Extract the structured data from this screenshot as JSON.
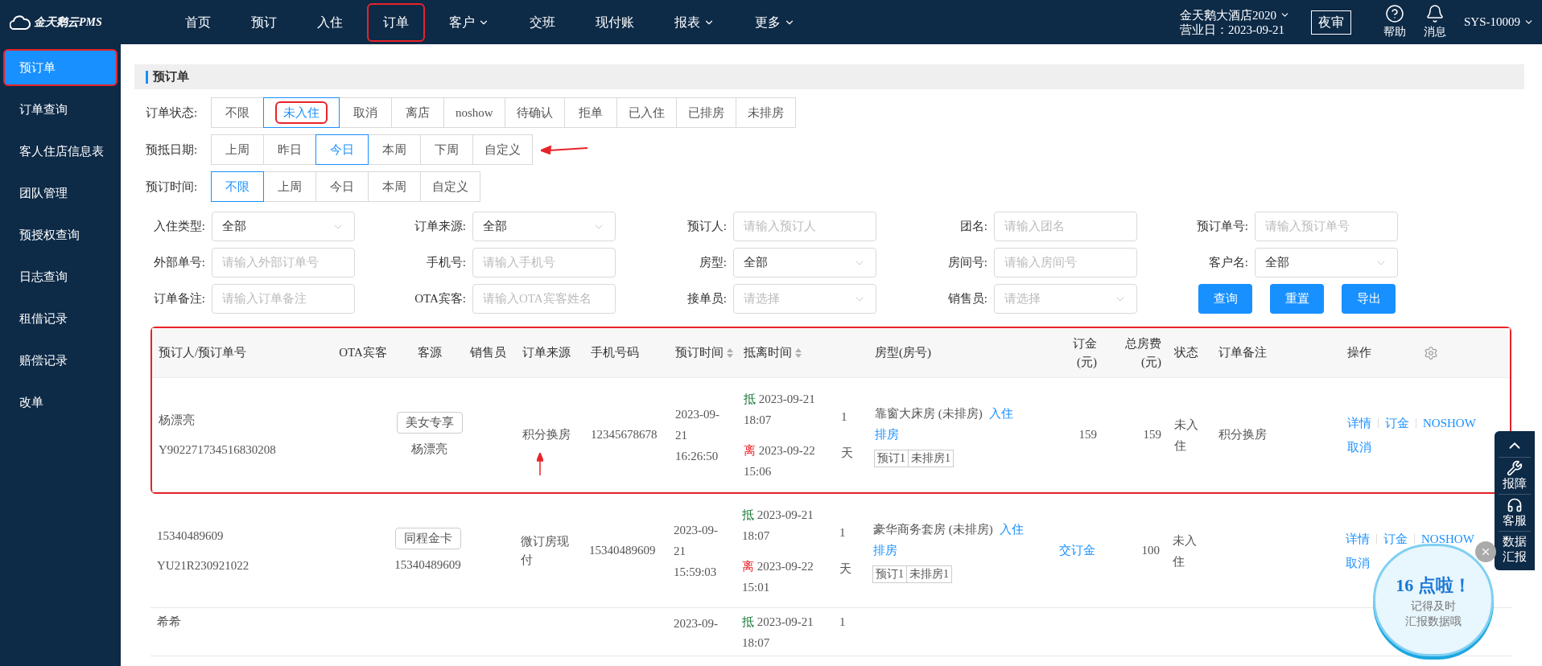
{
  "app": {
    "logo_text": "金天鹅云PMS"
  },
  "nav": [
    {
      "label": "首页",
      "dropdown": false,
      "annotated": false
    },
    {
      "label": "预订",
      "dropdown": false,
      "annotated": false
    },
    {
      "label": "入住",
      "dropdown": false,
      "annotated": false
    },
    {
      "label": "订单",
      "dropdown": false,
      "annotated": true
    },
    {
      "label": "客户",
      "dropdown": true,
      "annotated": false
    },
    {
      "label": "交班",
      "dropdown": false,
      "annotated": false
    },
    {
      "label": "现付账",
      "dropdown": false,
      "annotated": false
    },
    {
      "label": "报表",
      "dropdown": true,
      "annotated": false
    },
    {
      "label": "更多",
      "dropdown": true,
      "annotated": false
    }
  ],
  "hotel": {
    "name": "金天鹅大酒店2020",
    "business_day": "营业日：2023-09-21"
  },
  "night_audit": "夜审",
  "help": "帮助",
  "messages": "消息",
  "user": "SYS-10009",
  "sidebar": [
    {
      "label": "预订单",
      "selected": true,
      "annotated": true
    },
    {
      "label": "订单查询",
      "selected": false,
      "annotated": false
    },
    {
      "label": "客人住店信息表",
      "selected": false,
      "annotated": false
    },
    {
      "label": "团队管理",
      "selected": false,
      "annotated": false
    },
    {
      "label": "预授权查询",
      "selected": false,
      "annotated": false
    },
    {
      "label": "日志查询",
      "selected": false,
      "annotated": false
    },
    {
      "label": "租借记录",
      "selected": false,
      "annotated": false
    },
    {
      "label": "赔偿记录",
      "selected": false,
      "annotated": false
    },
    {
      "label": "改单",
      "selected": false,
      "annotated": false
    }
  ],
  "panel_title": "预订单",
  "filters": [
    {
      "label": "订单状态:",
      "arrow": false,
      "options": [
        {
          "label": "不限",
          "selected": false,
          "annotated": false
        },
        {
          "label": "未入住",
          "selected": true,
          "annotated": true
        },
        {
          "label": "取消",
          "selected": false,
          "annotated": false
        },
        {
          "label": "离店",
          "selected": false,
          "annotated": false
        },
        {
          "label": "noshow",
          "selected": false,
          "annotated": false
        },
        {
          "label": "待确认",
          "selected": false,
          "annotated": false
        },
        {
          "label": "拒单",
          "selected": false,
          "annotated": false
        },
        {
          "label": "已入住",
          "selected": false,
          "annotated": false
        },
        {
          "label": "已排房",
          "selected": false,
          "annotated": false
        },
        {
          "label": "未排房",
          "selected": false,
          "annotated": false
        }
      ]
    },
    {
      "label": "预抵日期:",
      "arrow": true,
      "options": [
        {
          "label": "上周",
          "selected": false,
          "annotated": false
        },
        {
          "label": "昨日",
          "selected": false,
          "annotated": false
        },
        {
          "label": "今日",
          "selected": true,
          "annotated": false
        },
        {
          "label": "本周",
          "selected": false,
          "annotated": false
        },
        {
          "label": "下周",
          "selected": false,
          "annotated": false
        },
        {
          "label": "自定义",
          "selected": false,
          "annotated": false
        }
      ]
    },
    {
      "label": "预订时间:",
      "arrow": false,
      "options": [
        {
          "label": "不限",
          "selected": true,
          "annotated": false
        },
        {
          "label": "上周",
          "selected": false,
          "annotated": false
        },
        {
          "label": "今日",
          "selected": false,
          "annotated": false
        },
        {
          "label": "本周",
          "selected": false,
          "annotated": false
        },
        {
          "label": "自定义",
          "selected": false,
          "annotated": false
        }
      ]
    }
  ],
  "form_fields": [
    {
      "label": "入住类型:",
      "kind": "select",
      "value": "全部"
    },
    {
      "label": "订单来源:",
      "kind": "select",
      "value": "全部"
    },
    {
      "label": "预订人:",
      "kind": "input",
      "placeholder": "请输入预订人"
    },
    {
      "label": "团名:",
      "kind": "input",
      "placeholder": "请输入团名"
    },
    {
      "label": "预订单号:",
      "kind": "input",
      "placeholder": "请输入预订单号"
    },
    {
      "label": "外部单号:",
      "kind": "input",
      "placeholder": "请输入外部订单号"
    },
    {
      "label": "手机号:",
      "kind": "input",
      "placeholder": "请输入手机号"
    },
    {
      "label": "房型:",
      "kind": "select",
      "value": "全部"
    },
    {
      "label": "房间号:",
      "kind": "input",
      "placeholder": "请输入房间号"
    },
    {
      "label": "客户名:",
      "kind": "select",
      "value": "全部"
    },
    {
      "label": "订单备注:",
      "kind": "input",
      "placeholder": "请输入订单备注"
    },
    {
      "label": "OTA宾客:",
      "kind": "input",
      "placeholder": "请输入OTA宾客姓名"
    },
    {
      "label": "接单员:",
      "kind": "select",
      "placeholder": "请选择"
    },
    {
      "label": "销售员:",
      "kind": "select",
      "placeholder": "请选择"
    }
  ],
  "buttons": [
    "查询",
    "重置",
    "导出"
  ],
  "table": {
    "annotated": true,
    "columns": [
      {
        "label": "预订人/预订单号",
        "sortable": false
      },
      {
        "label": "OTA宾客",
        "sortable": false
      },
      {
        "label": "客源",
        "sortable": false
      },
      {
        "label": "销售员",
        "sortable": false
      },
      {
        "label": "订单来源",
        "sortable": false
      },
      {
        "label": "手机号码",
        "sortable": false
      },
      {
        "label": "预订时间",
        "sortable": true
      },
      {
        "label": "抵离时间",
        "sortable": true
      },
      {
        "label": "房型(房号)",
        "sortable": false
      },
      {
        "label": "订金(元)",
        "sortable": false
      },
      {
        "label": "总房费(元)",
        "sortable": false
      },
      {
        "label": "状态",
        "sortable": false
      },
      {
        "label": "订单备注",
        "sortable": false
      },
      {
        "label": "操作",
        "sortable": false
      }
    ],
    "rows": [
      {
        "booker": "杨漂亮",
        "order_no": "Y902271734516830208",
        "source_tag": "美女专享",
        "source_name": "杨漂亮",
        "channel": "积分换房",
        "channel_arrow": true,
        "phone": "12345678678",
        "booked_at": [
          "2023-09-",
          "21",
          "16:26:50"
        ],
        "arrive": {
          "tag": "抵",
          "date": "2023-09-21",
          "time": "18:07"
        },
        "depart": {
          "tag": "离",
          "date": "2023-09-22",
          "time": "15:06"
        },
        "nights": "1",
        "nights_unit": "天",
        "room": "靠窗大床房 (未排房)",
        "room_links": [
          "入住",
          "排房"
        ],
        "room_tags": [
          "预订1",
          "未排房1"
        ],
        "deposit": {
          "text": "159",
          "link": false
        },
        "total": "159",
        "status": "未入住",
        "remark": "积分换房",
        "actions": [
          "详情",
          "订金",
          "NOSHOW",
          "取消"
        ]
      },
      {
        "booker": "15340489609",
        "order_no": "YU21R230921022",
        "source_tag": "同程金卡",
        "source_name": "15340489609",
        "channel": "微订房现付",
        "channel_arrow": false,
        "phone": "15340489609",
        "booked_at": [
          "2023-09-",
          "21",
          "15:59:03"
        ],
        "arrive": {
          "tag": "抵",
          "date": "2023-09-21",
          "time": "18:07"
        },
        "depart": {
          "tag": "离",
          "date": "2023-09-22",
          "time": "15:01"
        },
        "nights": "1",
        "nights_unit": "天",
        "room": "豪华商务套房 (未排房)",
        "room_links": [
          "入住",
          "排房"
        ],
        "room_tags": [
          "预订1",
          "未排房1"
        ],
        "deposit": {
          "text": "交订金",
          "link": true
        },
        "total": "100",
        "status": "未入住",
        "actions": [
          "详情",
          "订金",
          "NOSHOW",
          "取消"
        ]
      },
      {
        "booker": "希希",
        "booked_at": [
          "2023-09-"
        ],
        "arrive": {
          "tag": "抵",
          "date": "2023-09-21",
          "time": "18:07"
        },
        "nights": "1"
      }
    ]
  },
  "side_tools": [
    {
      "kind": "top"
    },
    {
      "kind": "wrench",
      "label": "报障"
    },
    {
      "kind": "headset",
      "label": "客服"
    },
    {
      "kind": "text",
      "label": "数据汇报"
    }
  ],
  "popup": {
    "title": "16 点啦！",
    "lines": [
      "记得及时",
      "汇报数据哦"
    ]
  }
}
